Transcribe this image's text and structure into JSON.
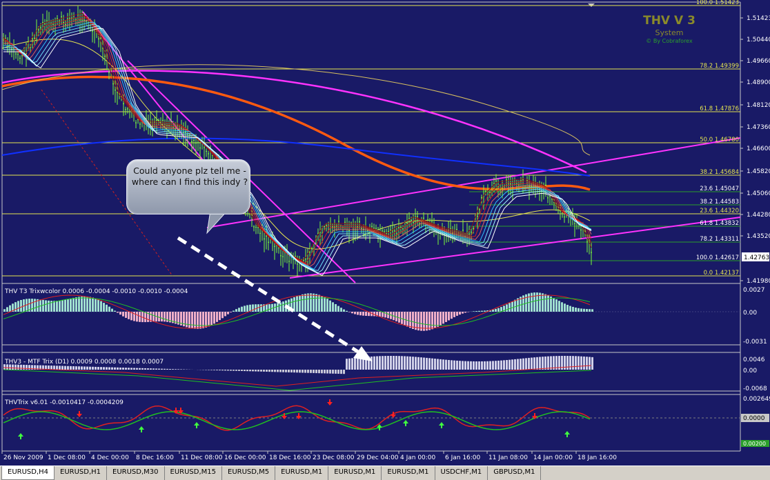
{
  "logo": {
    "title": "THV V 3",
    "subtitle": "System",
    "credit": "© By Cobraforex"
  },
  "callout": {
    "text": "Could anyone plz tell me - where can I find this indy ?"
  },
  "price_axis": {
    "labels": [
      "1.51423",
      "1.50440",
      "1.49660",
      "1.48900",
      "1.48120",
      "1.47360",
      "1.46600",
      "1.45820",
      "1.45060",
      "1.44280",
      "1.43520",
      "1.42763",
      "1.41980"
    ],
    "current_price": "1.42763"
  },
  "fib_levels_main": [
    {
      "label": "100.0 1.51423"
    },
    {
      "label": "78.2 1.49399"
    },
    {
      "label": "61.8 1.47876"
    },
    {
      "label": "50.0 1.46780"
    },
    {
      "label": "38.2 1.45684"
    },
    {
      "label": "23.6 1.44320"
    },
    {
      "label": "0.0 1.42137"
    }
  ],
  "fib_levels_minor": [
    {
      "label": "23.6 1.45047"
    },
    {
      "label": "38.2 1.44583"
    },
    {
      "label": "61.8 1.43832"
    },
    {
      "label": "78.2 1.43311"
    },
    {
      "label": "100.0 1.42617"
    }
  ],
  "indicators": [
    {
      "title": "THV T3 Trixwcolor 0.0006 -0.0004 -0.0010 -0.0010 -0.0004",
      "axis": [
        "0.0027",
        "0.00",
        "-0.0031"
      ]
    },
    {
      "title": "THV3 - MTF Trix (D1) 0.0009 0.0008 0.0018 0.0007",
      "axis": [
        "0.0046",
        "0.00",
        "-0.0068"
      ]
    },
    {
      "title": "THVTrix v6.01 -0.0010417 -0.0004209",
      "axis": [
        "0.002649",
        "0.0000",
        "0.00200"
      ]
    }
  ],
  "time_axis": [
    "26 Nov 2009",
    "1 Dec 08:00",
    "4 Dec 00:00",
    "8 Dec 16:00",
    "11 Dec 08:00",
    "16 Dec 00:00",
    "18 Dec 16:00",
    "23 Dec 08:00",
    "29 Dec 04:00",
    "4 Jan 00:00",
    "6 Jan 16:00",
    "11 Jan 08:00",
    "14 Jan 00:00",
    "18 Jan 16:00"
  ],
  "tabs": [
    "EURUSD,H4",
    "EURUSD,H1",
    "EURUSD,M30",
    "EURUSD,M15",
    "EURUSD,M5",
    "EURUSD,M1",
    "EURUSD,M1",
    "EURUSD,M1",
    "USDCHF,M1",
    "GBPUSD,M1"
  ],
  "colors": {
    "bg": "#191a66",
    "fib": "#e6e650",
    "magenta": "#ff33ff",
    "candles": "#7cff3a",
    "ema_orange": "#ff5a10",
    "ema_blue": "#1030ff"
  }
}
